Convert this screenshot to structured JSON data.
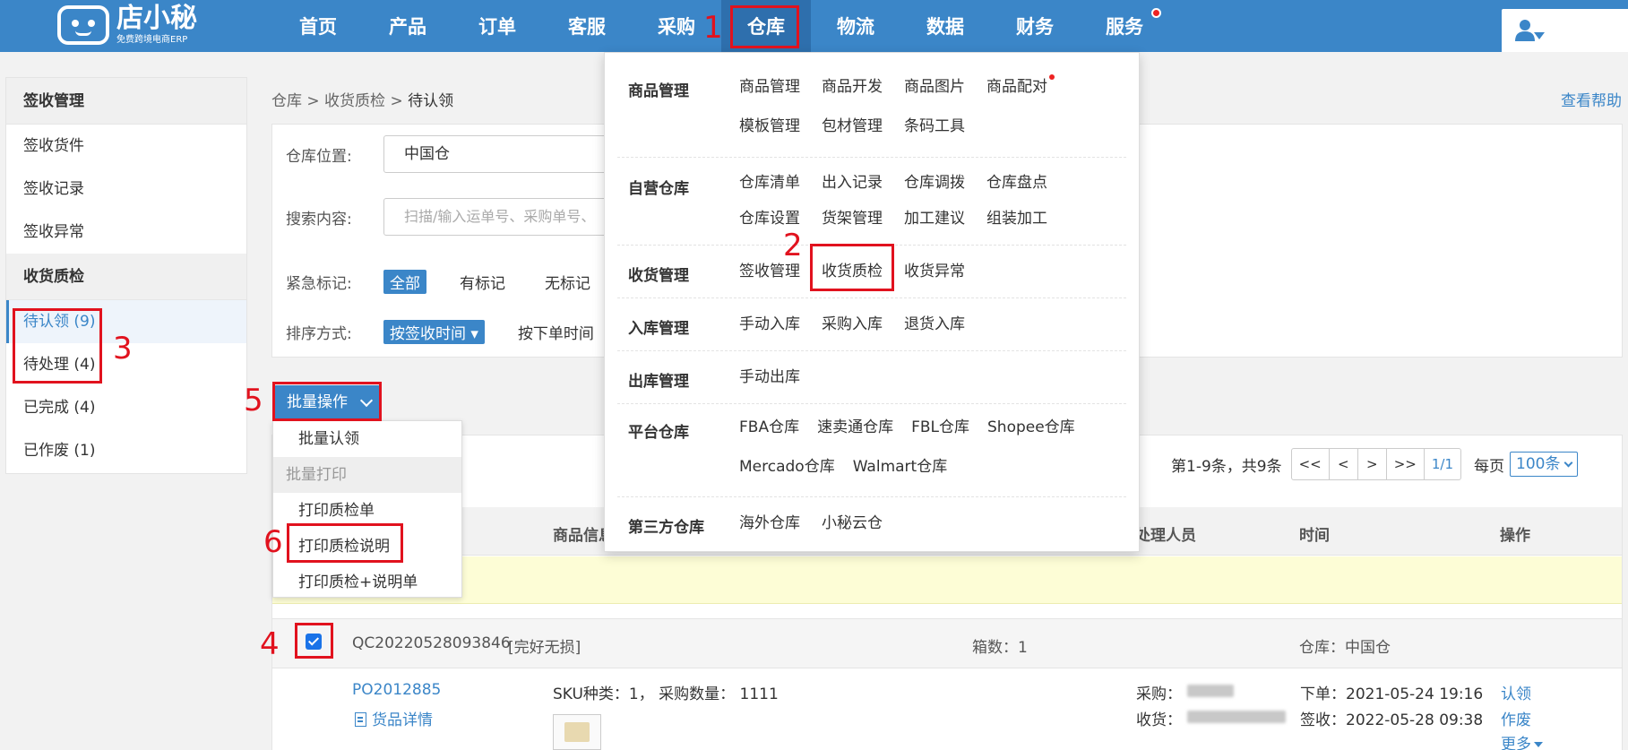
{
  "app": {
    "logo_name": "店小秘",
    "logo_sub": "免费跨境电商ERP"
  },
  "nav": [
    {
      "label": "首页"
    },
    {
      "label": "产品"
    },
    {
      "label": "订单"
    },
    {
      "label": "客服"
    },
    {
      "label": "采购"
    },
    {
      "label": "仓库",
      "active": true
    },
    {
      "label": "物流"
    },
    {
      "label": "数据"
    },
    {
      "label": "财务"
    },
    {
      "label": "服务"
    }
  ],
  "sidebar": {
    "group1": "签收管理",
    "group1_items": [
      "签收货件",
      "签收记录",
      "签收异常"
    ],
    "group2": "收货质检",
    "group2_items": [
      "待认领 (9)",
      "待处理 (4)",
      "已完成 (4)",
      "已作废 (1)"
    ]
  },
  "breadcrumb": {
    "path": "仓库 > 收货质检 > ",
    "current": "待认领"
  },
  "help": "查看帮助",
  "filters": {
    "warehouse_label": "仓库位置:",
    "warehouse_value": "中国仓",
    "search_label": "搜索内容:",
    "search_placeholder": "扫描/输入运单号、采购单号、",
    "urgent_label": "紧急标记:",
    "urgent_options": [
      "全部",
      "有标记",
      "无标记"
    ],
    "sort_label": "排序方式:",
    "sort_options": [
      "按签收时间 ▾",
      "按下单时间"
    ]
  },
  "batch": {
    "button": "批量操作",
    "menu": [
      "批量认领",
      "批量打印",
      "打印质检单",
      "打印质检说明",
      "打印质检+说明单"
    ]
  },
  "pager": {
    "info": "第1-9条，共9条",
    "buttons": [
      "<<",
      "<",
      ">",
      ">>",
      "1/1"
    ],
    "per_page_label": "每页",
    "per_page_value": "100条"
  },
  "table": {
    "headers": {
      "product": "商品信息",
      "handler": "处理人员",
      "time": "时间",
      "action": "操作"
    },
    "row": {
      "qc_no": "QC20220528093846",
      "status": "[完好无损]",
      "boxes": "箱数：1",
      "warehouse": "仓库：中国仓",
      "po": "PO2012885",
      "detail": "货品详情",
      "sku": "SKU种类：1，   采购数量：  1111",
      "buyer_label": "采购：",
      "receiver_label": "收货：",
      "order_time": "下单：2021-05-24 19:16",
      "sign_time": "签收：2022-05-28 09:38",
      "actions": [
        "认领",
        "作废",
        "更多"
      ]
    }
  },
  "mega": [
    {
      "title": "商品管理",
      "links": [
        "商品管理",
        "商品开发",
        "商品图片",
        "商品配对",
        "模板管理",
        "包材管理",
        "条码工具"
      ]
    },
    {
      "title": "自营仓库",
      "links": [
        "仓库清单",
        "出入记录",
        "仓库调拨",
        "仓库盘点",
        "仓库设置",
        "货架管理",
        "加工建议",
        "组装加工"
      ]
    },
    {
      "title": "收货管理",
      "links": [
        "签收管理",
        "收货质检",
        "收货异常"
      ]
    },
    {
      "title": "入库管理",
      "links": [
        "手动入库",
        "采购入库",
        "退货入库"
      ]
    },
    {
      "title": "出库管理",
      "links": [
        "手动出库"
      ]
    },
    {
      "title": "平台仓库",
      "links": [
        "FBA仓库",
        "速卖通仓库",
        "FBL仓库",
        "Shopee仓库",
        "Mercado仓库",
        "Walmart仓库"
      ]
    },
    {
      "title": "第三方仓库",
      "links": [
        "海外仓库",
        "小秘云仓"
      ]
    }
  ],
  "annotations": [
    "1",
    "2",
    "3",
    "4",
    "5",
    "6"
  ],
  "colors": {
    "brand": "#3b86c8",
    "annotation": "#e1121e"
  }
}
